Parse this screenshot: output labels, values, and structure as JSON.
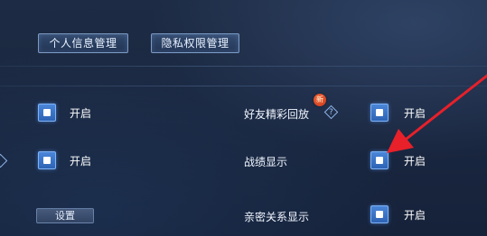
{
  "top_buttons": {
    "personal_info": "个人信息管理",
    "privacy": "隐私权限管理"
  },
  "toggle_on_label": "开启",
  "rows": [
    {
      "label": "",
      "checked": true
    },
    {
      "label": "好友精彩回放",
      "checked": true,
      "badge": "新",
      "help": "?"
    },
    {
      "label": "",
      "checked": true
    },
    {
      "label": "战绩显示",
      "checked": true
    },
    {
      "label": "亲密关系显示",
      "checked": true
    }
  ],
  "settings_button": "设置",
  "colors": {
    "accent": "#3b76c8",
    "arrow": "#e8202a"
  }
}
